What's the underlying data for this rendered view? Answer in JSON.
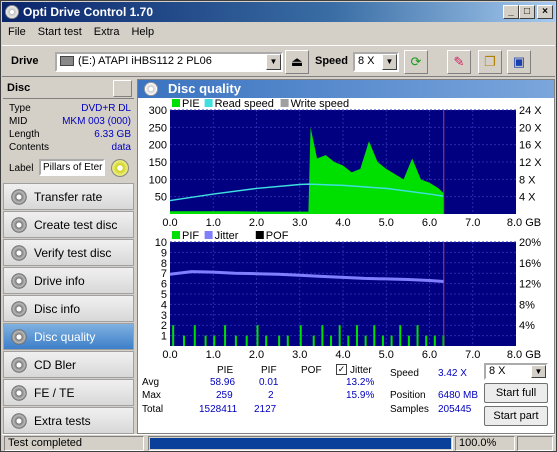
{
  "window": {
    "title": "Opti Drive Control 1.70",
    "buttons": [
      "_",
      "□",
      "×"
    ]
  },
  "menu": [
    "File",
    "Start test",
    "Extra",
    "Help"
  ],
  "toolbar": {
    "drive_label": "Drive",
    "drive_value": "(E:)   ATAPI iHBS112   2 PL06",
    "speed_label": "Speed",
    "speed_value": "8 X"
  },
  "disc": {
    "header": "Disc",
    "rows": [
      {
        "k": "Type",
        "v": "DVD+R DL"
      },
      {
        "k": "MID",
        "v": "MKM 003 (000)"
      },
      {
        "k": "Length",
        "v": "6.33 GB"
      },
      {
        "k": "Contents",
        "v": "data"
      }
    ],
    "label_key": "Label",
    "label_value": "Pillars of Etern"
  },
  "nav": [
    "Transfer rate",
    "Create test disc",
    "Verify test disc",
    "Drive info",
    "Disc info",
    "Disc quality",
    "CD Bler",
    "FE / TE",
    "Extra tests"
  ],
  "panel": {
    "title": "Disc quality"
  },
  "chart_data": [
    {
      "type": "area",
      "legend": [
        "PIE",
        "Read speed",
        "Write speed"
      ],
      "colors": {
        "PIE": "#00e000",
        "Read speed": "#40e0e0",
        "Write speed": "#a0a0a0"
      },
      "x": [
        0.0,
        0.5,
        1.0,
        1.5,
        2.0,
        2.5,
        3.0,
        3.2,
        3.25,
        3.4,
        3.6,
        3.8,
        4.0,
        4.2,
        4.4,
        4.6,
        4.8,
        5.0,
        5.2,
        5.4,
        5.6,
        5.8,
        6.0,
        6.2,
        6.33
      ],
      "pie": [
        8,
        8,
        8,
        8,
        7,
        7,
        7,
        7,
        250,
        160,
        170,
        150,
        140,
        120,
        130,
        210,
        150,
        130,
        115,
        100,
        160,
        100,
        90,
        75,
        60
      ],
      "speed_x": [
        0,
        1,
        2,
        3,
        3.2,
        4,
        5,
        6,
        6.33
      ],
      "speed": [
        3.1,
        4.6,
        5.9,
        6.8,
        6.9,
        6.6,
        5.9,
        4.6,
        4.1
      ],
      "xticks": [
        "0.0",
        "1.0",
        "2.0",
        "3.0",
        "4.0",
        "5.0",
        "6.0",
        "7.0",
        "8.0 GB"
      ],
      "yleft": [
        "50",
        "100",
        "150",
        "200",
        "250",
        "300"
      ],
      "yright": [
        "4 X",
        "8 X",
        "12 X",
        "16 X",
        "20 X",
        "24 X"
      ],
      "xlim": [
        0,
        8
      ],
      "ylim": [
        0,
        300
      ]
    },
    {
      "type": "bar",
      "legend": [
        "PIF",
        "Jitter",
        "POF"
      ],
      "colors": {
        "PIF": "#00e000",
        "Jitter": "#8080ff",
        "POF": "#000000"
      },
      "jitter_x": [
        0,
        0.5,
        1.0,
        1.5,
        2.0,
        2.5,
        3.0,
        3.5,
        4.0,
        4.5,
        5.0,
        5.5,
        6.0,
        6.33
      ],
      "jitter": [
        13.8,
        14.3,
        14.2,
        14.0,
        13.9,
        13.8,
        13.6,
        13.4,
        13.2,
        13.0,
        12.9,
        12.8,
        12.6,
        12.4
      ],
      "pif_x": [
        0.05,
        0.3,
        0.55,
        0.8,
        1.0,
        1.25,
        1.5,
        1.75,
        2.0,
        2.2,
        2.5,
        2.7,
        3.0,
        3.3,
        3.5,
        3.7,
        3.9,
        4.1,
        4.3,
        4.5,
        4.7,
        4.9,
        5.1,
        5.3,
        5.5,
        5.7,
        5.9,
        6.1,
        6.3
      ],
      "pif": [
        2,
        1,
        2,
        1,
        1,
        2,
        1,
        1,
        2,
        1,
        1,
        1,
        2,
        1,
        2,
        1,
        2,
        1,
        2,
        1,
        2,
        1,
        1,
        2,
        1,
        2,
        1,
        1,
        1
      ],
      "xticks": [
        "0.0",
        "1.0",
        "2.0",
        "3.0",
        "4.0",
        "5.0",
        "6.0",
        "7.0",
        "8.0 GB"
      ],
      "yleft": [
        "1",
        "2",
        "3",
        "4",
        "5",
        "6",
        "7",
        "8",
        "9",
        "10"
      ],
      "yright": [
        "4%",
        "8%",
        "12%",
        "16%",
        "20%"
      ],
      "xlim": [
        0,
        8
      ],
      "ylim": [
        0,
        10
      ],
      "jitter_ylim": [
        0,
        20
      ]
    }
  ],
  "stats": {
    "headers": [
      "PIE",
      "PIF",
      "POF"
    ],
    "jitter_label": "Jitter",
    "jitter_checked": true,
    "rows": [
      {
        "label": "Avg",
        "pie": "58.96",
        "pif": "0.01",
        "jitter": "13.2%"
      },
      {
        "label": "Max",
        "pie": "259",
        "pif": "2",
        "jitter": "15.9%"
      },
      {
        "label": "Total",
        "pie": "1528411",
        "pif": "2127",
        "jitter": ""
      }
    ],
    "speed_label": "Speed",
    "speed_value": "3.42 X",
    "position_label": "Position",
    "position_value": "6480 MB",
    "samples_label": "Samples",
    "samples_value": "205445",
    "speed_select": "8 X",
    "start_full": "Start full",
    "start_part": "Start part"
  },
  "status": {
    "text": "Test completed",
    "progress": 1.0,
    "percent": "100.0%"
  }
}
